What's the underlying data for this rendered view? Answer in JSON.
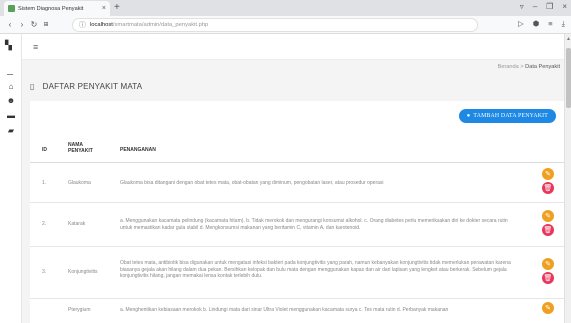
{
  "browser": {
    "tab_title": "Sistem Diagnosa Penyakit",
    "url_host": "localhost",
    "url_path": "/smartmata/admin/data_penyakit.php"
  },
  "breadcrumb": {
    "home": "Beranda",
    "sep": ">",
    "current": "Data Penyakit"
  },
  "page_title": "DAFTAR PENYAKIT MATA",
  "add_button": "TAMBAH DATA PENYAKIT",
  "table": {
    "headers": {
      "id": "ID",
      "nama_line1": "NAMA",
      "nama_line2": "PENYAKIT",
      "penanganan": "PENANGANAN"
    },
    "rows": [
      {
        "id": "1.",
        "nama": "Glaukoma",
        "penanganan": "Glaukoma bisa ditangani dengan obat tetes mata, obat-obatan yang diminum, pengobatan laser, atau prosedur operasi"
      },
      {
        "id": "2.",
        "nama": "Katarak",
        "penanganan": "a. Menggunakan kacamata pelindung (kacamata hitam). b. Tidak merokok dan mengurangi konsumsi alkohol. c. Orang diabetes perlu memeriksakan diri ke dokter secara rutin untuk memastikan kadar gula stabil d. Mengkonsumsi makanan yang beritamin C, vitamin A, dan karotenoid."
      },
      {
        "id": "3.",
        "nama": "Konjungtivitis",
        "penanganan": "Obat tetes mata, antibiotik bisa digunakan untuk mengatasi infeksi bakteri pada konjungtivitis yang parah, namun kebanyakan konjungtivitis tidak memerlukan perawatan karena biasanya gejala akan hilang dalam dua pekan. Bersihkan kelopak dan bulu mata dengan menggunakan kapas dan air dari lapisan yang lengket atau berkerak. Sebelum gejala konjungtivitis hilang, jangan memakai lensa kontak terlebih dulu."
      },
      {
        "id": "",
        "nama": "Pterygium",
        "penanganan": "a. Menghentikan kebiasaan merokok b. Lindungi mata dari sinar Ultra Violet menggunakan kacamata surya c. Tes mata rutin d. Perbanyak makanan"
      }
    ]
  }
}
